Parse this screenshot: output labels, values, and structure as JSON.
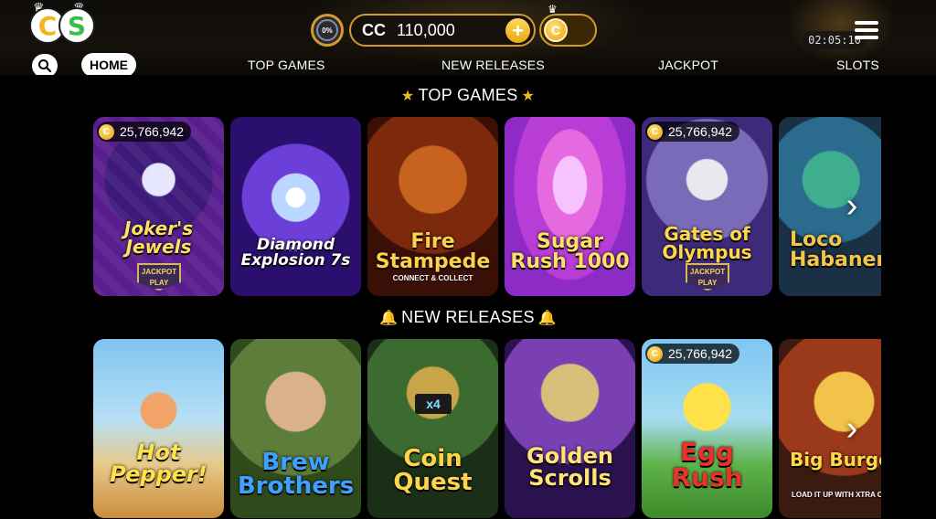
{
  "header": {
    "logo": {
      "left": "C",
      "right": "S",
      "icon": "crown-icon"
    },
    "progress_badge": {
      "label": "0%",
      "value": 0
    },
    "balance": {
      "currency": "CC",
      "amount": "110,000",
      "add_icon": "plus-icon"
    },
    "sweeps_wallet": {
      "coin_letter": "C",
      "icon": "crown-icon"
    },
    "timer": "02:05:10",
    "menu_icon": "hamburger-menu-icon"
  },
  "nav": {
    "search_icon": "search-icon",
    "home": "HOME",
    "top_games": "TOP GAMES",
    "new_releases": "NEW RELEASES",
    "jackpot": "JACKPOT",
    "slots": "SLOTS"
  },
  "sections": {
    "top_games": {
      "title": "TOP GAMES",
      "icon": "star-icon",
      "games": [
        {
          "name": "Joker's Jewels",
          "sub": "JACKPOT PLAY",
          "jackpot": "25,766,942"
        },
        {
          "name": "Diamond Explosion 7s"
        },
        {
          "name": "Fire Stampede",
          "sub": "CONNECT & COLLECT"
        },
        {
          "name": "Sugar Rush 1000"
        },
        {
          "name": "Gates of Olympus",
          "sub": "JACKPOT PLAY",
          "jackpot": "25,766,942"
        },
        {
          "name": "Loco Habanero"
        }
      ]
    },
    "new_releases": {
      "title": "NEW RELEASES",
      "icon": "bell-icon",
      "games": [
        {
          "name": "Hot Pepper!"
        },
        {
          "name": "Brew Brothers"
        },
        {
          "name": "Coin Quest",
          "badge": "x4"
        },
        {
          "name": "Golden Scrolls"
        },
        {
          "name": "Egg Rush",
          "jackpot": "25,766,942"
        },
        {
          "name": "Big Burger",
          "sub": "LOAD IT UP WITH XTRA CHEESE"
        }
      ]
    }
  },
  "colors": {
    "accent": "#d39a2e",
    "gold": "#f3b823",
    "background": "#000000"
  }
}
